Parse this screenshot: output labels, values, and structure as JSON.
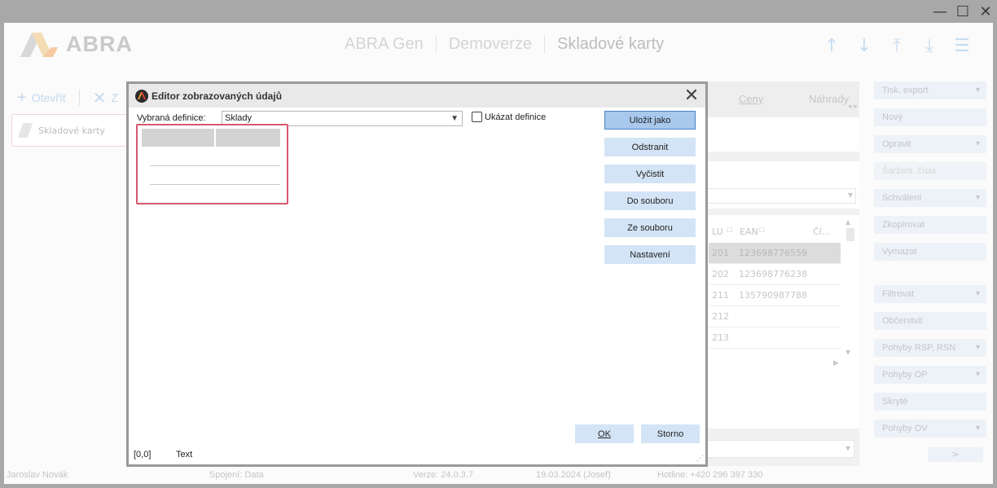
{
  "window": {
    "controls": {
      "minimize": "—",
      "maximize": "☐",
      "close": "✕"
    }
  },
  "header": {
    "logo_text": "ABRA",
    "crumbs": [
      "ABRA Gen",
      "Demoverze"
    ],
    "current": "Skladové karty",
    "nav_icons": [
      "↑",
      "↓",
      "⤒",
      "⤓",
      "☰"
    ]
  },
  "left_toolbar": {
    "open_label": "Otevřít",
    "close_label": "Z"
  },
  "tab": {
    "label": "Skladové karty"
  },
  "background": {
    "tabs": [
      "Ceny",
      "Náhrady"
    ],
    "grid_header": [
      "LU",
      "EAN",
      "Čí..."
    ],
    "rows": [
      {
        "c1": "201",
        "c2": "123698776559"
      },
      {
        "c1": "202",
        "c2": "123698776238"
      },
      {
        "c1": "211",
        "c2": "135790987788"
      },
      {
        "c1": "212",
        "c2": ""
      },
      {
        "c1": "213",
        "c2": ""
      }
    ]
  },
  "actions": {
    "items": [
      "Tisk, export",
      "Nový",
      "Opravit",
      "Šarže/s. čísla",
      "Schválení",
      "Zkopírovat",
      "Vymazat",
      "Filtrovat",
      "Občerstvit",
      "Pohyby RSP, RSN",
      "Pohyby OP",
      "Skryté",
      "Pohyby OV"
    ],
    "more": ">"
  },
  "statusbar": {
    "user": "Jaroslav Novák",
    "connection": "Spojení: Data",
    "version": "Verze: 24.0.3.7",
    "date": "19.03.2024 (Josef)",
    "hotline": "Hotline: +420 296 397 330"
  },
  "dialog": {
    "title": "Editor zobrazovaných údajů",
    "close": "✕",
    "definition_label": "Vybraná definice:",
    "definition_value": "Sklady",
    "show_definitions_label": "Ukázat definice",
    "buttons": {
      "save_as": "Uložit jako",
      "remove": "Odstranit",
      "clear": "Vyčistit",
      "to_file": "Do souboru",
      "from_file": "Ze souboru",
      "settings": "Nastavení",
      "ok": "OK",
      "cancel": "Storno"
    },
    "status_pos": "[0,0]",
    "status_text": "Text"
  },
  "colors": {
    "accent": "#4a85c6",
    "button_bg": "#d3e4f6",
    "selection_border": "#d6586f"
  }
}
